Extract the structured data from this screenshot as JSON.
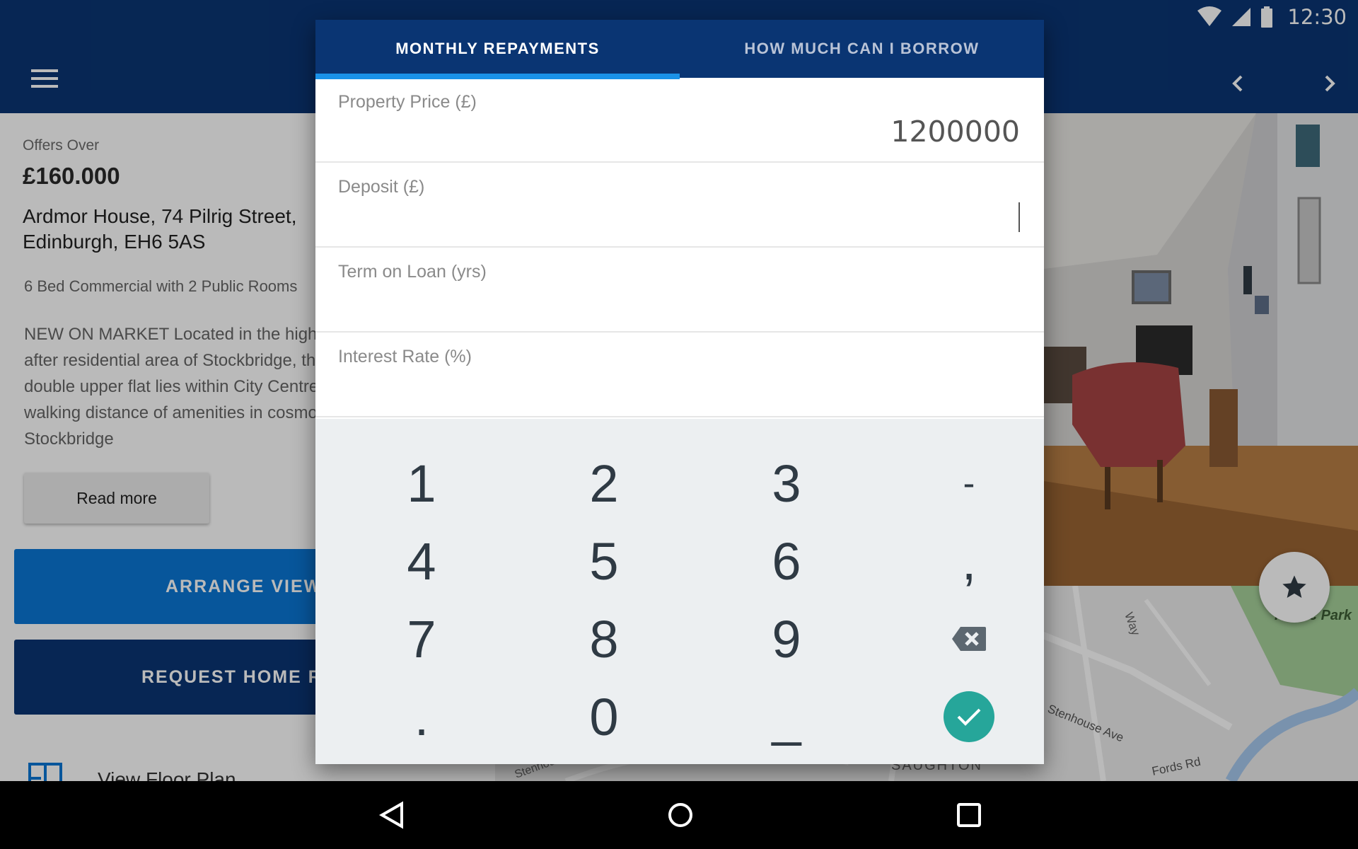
{
  "status_bar": {
    "time": "12:30"
  },
  "listing": {
    "offers_label": "Offers Over",
    "price": "£160.000",
    "address_line1": "Ardmor House, 74 Pilrig Street,",
    "address_line2": "Edinburgh, EH6 5AS",
    "summary": "6 Bed Commercial with 2 Public Rooms",
    "description": "NEW ON MARKET Located in the highly sought after residential area of Stockbridge, this bedroom double upper flat lies within City Centre and within walking distance of amenities in cosmopolitan Stockbridge",
    "read_more_label": "Read more",
    "arrange_viewing_label": "ARRANGE VIEWING",
    "request_home_report_label": "REQUEST HOME REPORT",
    "floor_plan_label": "View Floor Plan"
  },
  "map": {
    "labels": [
      "Stenhouse Ave",
      "SAUGHTON",
      "Way",
      "Public Park",
      "Fords Rd",
      "Stenhouse"
    ]
  },
  "calculator": {
    "tabs": [
      {
        "label": "MONTHLY REPAYMENTS",
        "active": true
      },
      {
        "label": "HOW MUCH CAN I BORROW",
        "active": false
      }
    ],
    "fields": [
      {
        "label": "Property Price (£)",
        "value": "1200000"
      },
      {
        "label": "Deposit (£)",
        "value": ""
      },
      {
        "label": "Term on Loan (yrs)",
        "value": ""
      },
      {
        "label": "Interest Rate (%)",
        "value": ""
      }
    ],
    "keypad": {
      "keys": [
        "1",
        "2",
        "3",
        "-",
        "4",
        "5",
        "6",
        ",",
        "7",
        "8",
        "9",
        ".",
        "0",
        "_"
      ]
    }
  },
  "colors": {
    "primary_dark": "#0a3573",
    "primary": "#0a77d5",
    "tab_indicator": "#1a92e8",
    "keypad_bg": "#eceff1",
    "done_button": "#26a69a"
  },
  "icons": [
    "menu-icon",
    "chevron-left-icon",
    "chevron-right-icon",
    "star-icon",
    "floor-plan-icon",
    "backspace-icon",
    "check-icon",
    "wifi-icon",
    "signal-icon",
    "battery-icon",
    "back-icon",
    "home-icon",
    "recents-icon"
  ]
}
